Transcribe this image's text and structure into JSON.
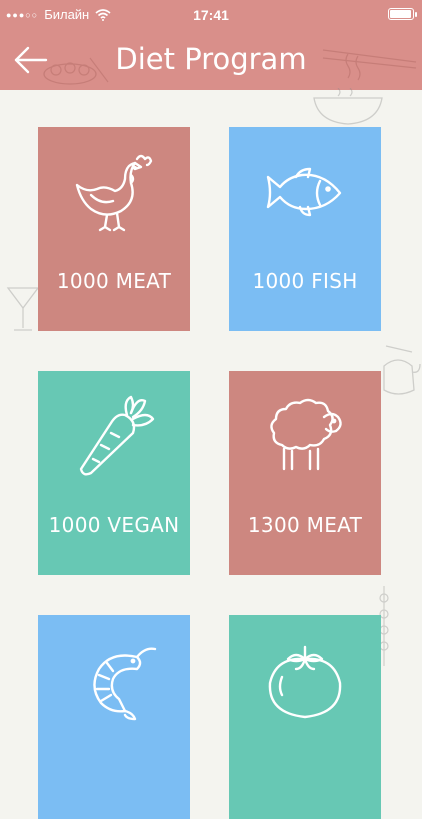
{
  "status": {
    "carrier": "Билайн",
    "time": "17:41",
    "battery_level": 0.95
  },
  "nav": {
    "title": "Diet Program",
    "back_icon": "arrow-left-icon"
  },
  "colors": {
    "header": "#d98f8a",
    "meat": "#cd8780",
    "fish": "#7bbdf3",
    "vegan": "#67c8b4",
    "background": "#f4f4ef"
  },
  "programs": [
    {
      "label": "1000 MEAT",
      "icon": "chicken-icon"
    },
    {
      "label": "1000 FISH",
      "icon": "fish-icon"
    },
    {
      "label": "1000 VEGAN",
      "icon": "carrot-icon"
    },
    {
      "label": "1300 MEAT",
      "icon": "sheep-icon"
    },
    {
      "label": "",
      "icon": "shrimp-icon"
    },
    {
      "label": "",
      "icon": "tomato-icon"
    }
  ]
}
